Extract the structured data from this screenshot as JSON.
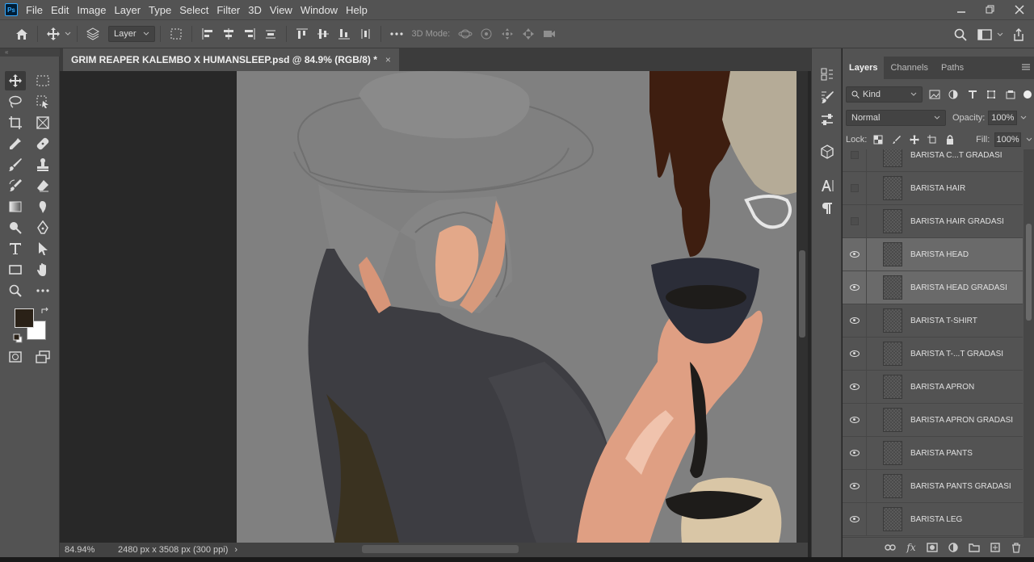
{
  "app": {
    "logo": "Ps",
    "menu": [
      "File",
      "Edit",
      "Image",
      "Layer",
      "Type",
      "Select",
      "Filter",
      "3D",
      "View",
      "Window",
      "Help"
    ],
    "window_controls": [
      "minimize-icon",
      "restore-icon",
      "close-icon"
    ]
  },
  "options_bar": {
    "auto_select_value": "Layer",
    "three_d_mode_label": "3D Mode:"
  },
  "document": {
    "tab_title": "GRIM REAPER KALEMBO X HUMANSLEEP.psd @ 84.9% (RGB/8) *",
    "close_glyph": "×"
  },
  "status_bar": {
    "zoom": "84.94%",
    "dimensions": "2480 px x 3508 px (300 ppi)",
    "more_glyph": "›"
  },
  "colors": {
    "foreground": "#2a2117",
    "background": "#ffffff",
    "canvas_bg": "#808080"
  },
  "layers_panel": {
    "tabs": [
      "Layers",
      "Channels",
      "Paths"
    ],
    "filter_kind": "Kind",
    "blend_mode": "Normal",
    "opacity_label": "Opacity:",
    "opacity_value": "100%",
    "lock_label": "Lock:",
    "fill_label": "Fill:",
    "fill_value": "100%",
    "layers": [
      {
        "name": "BARISTA C...T GRADASI",
        "visible": false,
        "selected": false
      },
      {
        "name": "BARISTA HAIR",
        "visible": false,
        "selected": false
      },
      {
        "name": "BARISTA HAIR GRADASI",
        "visible": false,
        "selected": false
      },
      {
        "name": "BARISTA HEAD",
        "visible": true,
        "selected": true
      },
      {
        "name": "BARISTA HEAD GRADASI",
        "visible": true,
        "selected": true
      },
      {
        "name": "BARISTA T-SHIRT",
        "visible": true,
        "selected": false
      },
      {
        "name": "BARISTA T-...T GRADASI",
        "visible": true,
        "selected": false
      },
      {
        "name": "BARISTA APRON",
        "visible": true,
        "selected": false
      },
      {
        "name": "BARISTA APRON GRADASI",
        "visible": true,
        "selected": false
      },
      {
        "name": "BARISTA PANTS",
        "visible": true,
        "selected": false
      },
      {
        "name": "BARISTA PANTS GRADASI",
        "visible": true,
        "selected": false
      },
      {
        "name": "BARISTA LEG",
        "visible": true,
        "selected": false
      }
    ],
    "footer_icons": [
      "link-icon",
      "fx-icon",
      "mask-icon",
      "adjustment-icon",
      "folder-icon",
      "new-layer-icon",
      "trash-icon"
    ]
  }
}
